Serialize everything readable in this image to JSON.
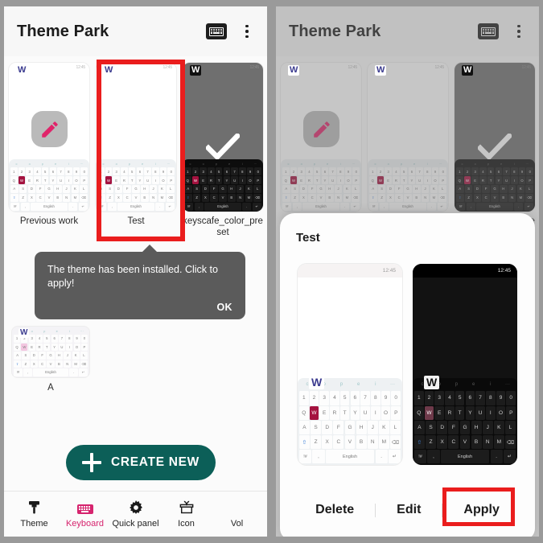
{
  "app": {
    "title": "Theme Park",
    "keyboard_icon": "keyboard-icon",
    "overflow_icon": "more-vertical-icon"
  },
  "accent_colors": {
    "highlight_box": "#ea1d1d",
    "create_button": "#0c5f58",
    "active_nav": "#d6246e",
    "keyboard_accent_key": "#a4123f",
    "toast_background": "#5b5b5b"
  },
  "cards": [
    {
      "label": "Previous work",
      "state": "editable",
      "badge_icon": "pencil-icon",
      "theme": "light",
      "status_time": "12:45"
    },
    {
      "label": "Test",
      "state": "selected",
      "badge_icon": "",
      "theme": "light",
      "status_time": "12:45"
    },
    {
      "label": "keyscafe_color_preset",
      "state": "applied",
      "badge_icon": "check-icon",
      "theme": "dark",
      "status_time": "12:45"
    }
  ],
  "second_row": [
    {
      "label": "A",
      "theme": "light"
    }
  ],
  "toast": {
    "message": "The theme has been installed. Click to apply!",
    "action": "OK"
  },
  "create_button": {
    "label": "CREATE NEW",
    "icon": "plus-icon"
  },
  "bottom_nav": {
    "items": [
      {
        "label": "Theme",
        "icon": "paint-roller-icon",
        "active": false
      },
      {
        "label": "Keyboard",
        "icon": "keyboard-icon",
        "active": true
      },
      {
        "label": "Quick panel",
        "icon": "gear-icon",
        "active": false
      },
      {
        "label": "Icon",
        "icon": "gift-icon",
        "active": false
      },
      {
        "label": "Vol",
        "icon": "",
        "active": false
      }
    ]
  },
  "sheet": {
    "title": "Test",
    "previews": [
      {
        "theme": "light",
        "status_time": "12:45"
      },
      {
        "theme": "dark",
        "status_time": "12:45"
      }
    ],
    "actions": [
      {
        "label": "Delete",
        "highlighted": false
      },
      {
        "label": "Edit",
        "highlighted": false
      },
      {
        "label": "Apply",
        "highlighted": true
      }
    ]
  },
  "keyboard_preview": {
    "toolbar_icons": [
      "c",
      "o",
      "p",
      "e",
      "i",
      "..."
    ],
    "rows": [
      [
        "1",
        "2",
        "3",
        "4",
        "5",
        "6",
        "7",
        "8",
        "9",
        "0"
      ],
      [
        "Q",
        "W",
        "E",
        "R",
        "T",
        "Y",
        "U",
        "I",
        "O",
        "P"
      ],
      [
        "A",
        "S",
        "D",
        "F",
        "G",
        "H",
        "J",
        "K",
        "L"
      ],
      [
        "Z",
        "X",
        "C",
        "V",
        "B",
        "N",
        "M"
      ],
      [
        "English"
      ]
    ],
    "accent_key": "W",
    "overlay_letter": "W",
    "space_label": "English"
  }
}
